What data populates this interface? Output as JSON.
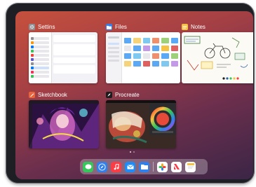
{
  "apps": {
    "settings": {
      "name": "Settins"
    },
    "files": {
      "name": "Files"
    },
    "notes": {
      "name": "Notes"
    },
    "sketchbook": {
      "name": "Sketchbook"
    },
    "procreate": {
      "name": "Procreate"
    }
  },
  "dock": {
    "icons": [
      "messages-icon",
      "safari-icon",
      "music-icon",
      "mail-icon",
      "files-icon",
      "photos-icon",
      "news-icon",
      "notes-icon"
    ]
  },
  "colors": {
    "wallpaper_top": "#c6503d",
    "wallpaper_bottom": "#3b2546",
    "settings_icon": "#8e8e93",
    "files_icon": "#2f80ed",
    "notes_icon": "#f5c243",
    "sketchbook_icon": "#e8643c",
    "procreate_icon": "#1c1c1e"
  }
}
